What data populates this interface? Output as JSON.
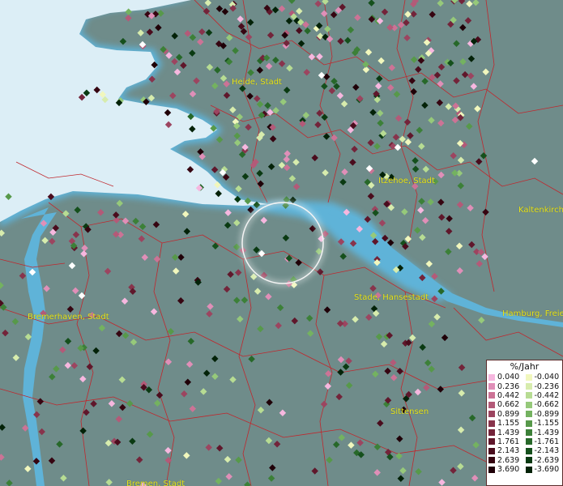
{
  "places": [
    {
      "name": "Heide, Stadt"
    },
    {
      "name": "Itzehoe, Stadt"
    },
    {
      "name": "Kaltenkirch"
    },
    {
      "name": "Stade, Hansestadt"
    },
    {
      "name": "Bremerhaven, Stadt"
    },
    {
      "name": "Hamburg, Freie"
    },
    {
      "name": "Sittensen"
    },
    {
      "name": "Bremen, Stadt"
    }
  ],
  "legend": {
    "title": "%/Jahr",
    "positive": [
      {
        "label": "0.040",
        "color": "#f6b7df"
      },
      {
        "label": "0.236",
        "color": "#e08fb8"
      },
      {
        "label": "0.442",
        "color": "#cc7396"
      },
      {
        "label": "0.662",
        "color": "#b35a78"
      },
      {
        "label": "0.899",
        "color": "#9c4560"
      },
      {
        "label": "1.155",
        "color": "#88344c"
      },
      {
        "label": "1.439",
        "color": "#73243a"
      },
      {
        "label": "1.761",
        "color": "#5f172b"
      },
      {
        "label": "2.143",
        "color": "#4a0c1d"
      },
      {
        "label": "2.639",
        "color": "#360511"
      },
      {
        "label": "3.690",
        "color": "#1f0008"
      }
    ],
    "negative": [
      {
        "label": "-0.040",
        "color": "#f1f7bd"
      },
      {
        "label": "-0.236",
        "color": "#d7ecad"
      },
      {
        "label": "-0.442",
        "color": "#b7dc93"
      },
      {
        "label": "-0.662",
        "color": "#96c97a"
      },
      {
        "label": "-0.899",
        "color": "#74b260"
      },
      {
        "label": "-1.155",
        "color": "#57994a"
      },
      {
        "label": "-1.439",
        "color": "#3c8038"
      },
      {
        "label": "-1.761",
        "color": "#276829"
      },
      {
        "label": "-2.143",
        "color": "#15501c"
      },
      {
        "label": "-2.639",
        "color": "#0a3a12"
      },
      {
        "label": "-3.690",
        "color": "#032208"
      }
    ]
  },
  "colors": {
    "land": "#6f8c8a",
    "sea": "#dceef6",
    "water": "#5fb3d8",
    "borders": "#c0272d",
    "label": "#e8e41a",
    "selection": "#ffffff",
    "no_data": "#ffffff"
  }
}
